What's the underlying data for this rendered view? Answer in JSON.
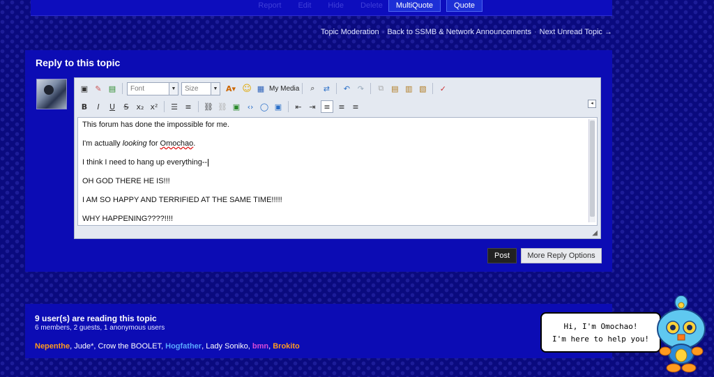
{
  "post_actions": {
    "report": "Report",
    "edit": "Edit",
    "hide": "Hide",
    "delete": "Delete",
    "multiquote": "MultiQuote",
    "quote": "Quote"
  },
  "moderation_bar": {
    "topic_moderation": "Topic Moderation",
    "back_link": "Back to SSMB & Network Announcements",
    "next_unread": "Next Unread Topic →"
  },
  "reply": {
    "title": "Reply to this topic",
    "font_placeholder": "Font",
    "size_placeholder": "Size",
    "my_media": "My Media",
    "lines": [
      "This forum has done the impossible for me.",
      "I'm actually ",
      "looking",
      " for ",
      "Omochao",
      ".",
      "I think I need to hang up everything--",
      "OH GOD THERE HE IS!!!",
      "I AM SO HAPPY AND TERRIFIED AT THE SAME TIME!!!!!",
      "WHY HAPPENING????!!!!"
    ],
    "post_button": "Post",
    "more_button": "More Reply Options"
  },
  "readers": {
    "title": "9 user(s) are reading this topic",
    "subtitle": "6 members, 2 guests, 1 anonymous users",
    "users": [
      {
        "name": "Nepenthe",
        "color": "#ff9a1f",
        "bold": true
      },
      {
        "name": "Jude*",
        "color": "#ffffff",
        "bold": false
      },
      {
        "name": "Crow the BOOLET",
        "color": "#ffffff",
        "bold": false
      },
      {
        "name": "Hogfather",
        "color": "#5aa8ff",
        "bold": true
      },
      {
        "name": "Lady Soniko",
        "color": "#ffffff",
        "bold": false
      },
      {
        "name": "bmn",
        "color": "#d94bd9",
        "bold": true
      },
      {
        "name": "Brokito",
        "color": "#ff9a1f",
        "bold": true
      }
    ]
  },
  "omochao": {
    "line1": "Hi, I'm Omochao!",
    "line2": "I'm here to help you!"
  }
}
